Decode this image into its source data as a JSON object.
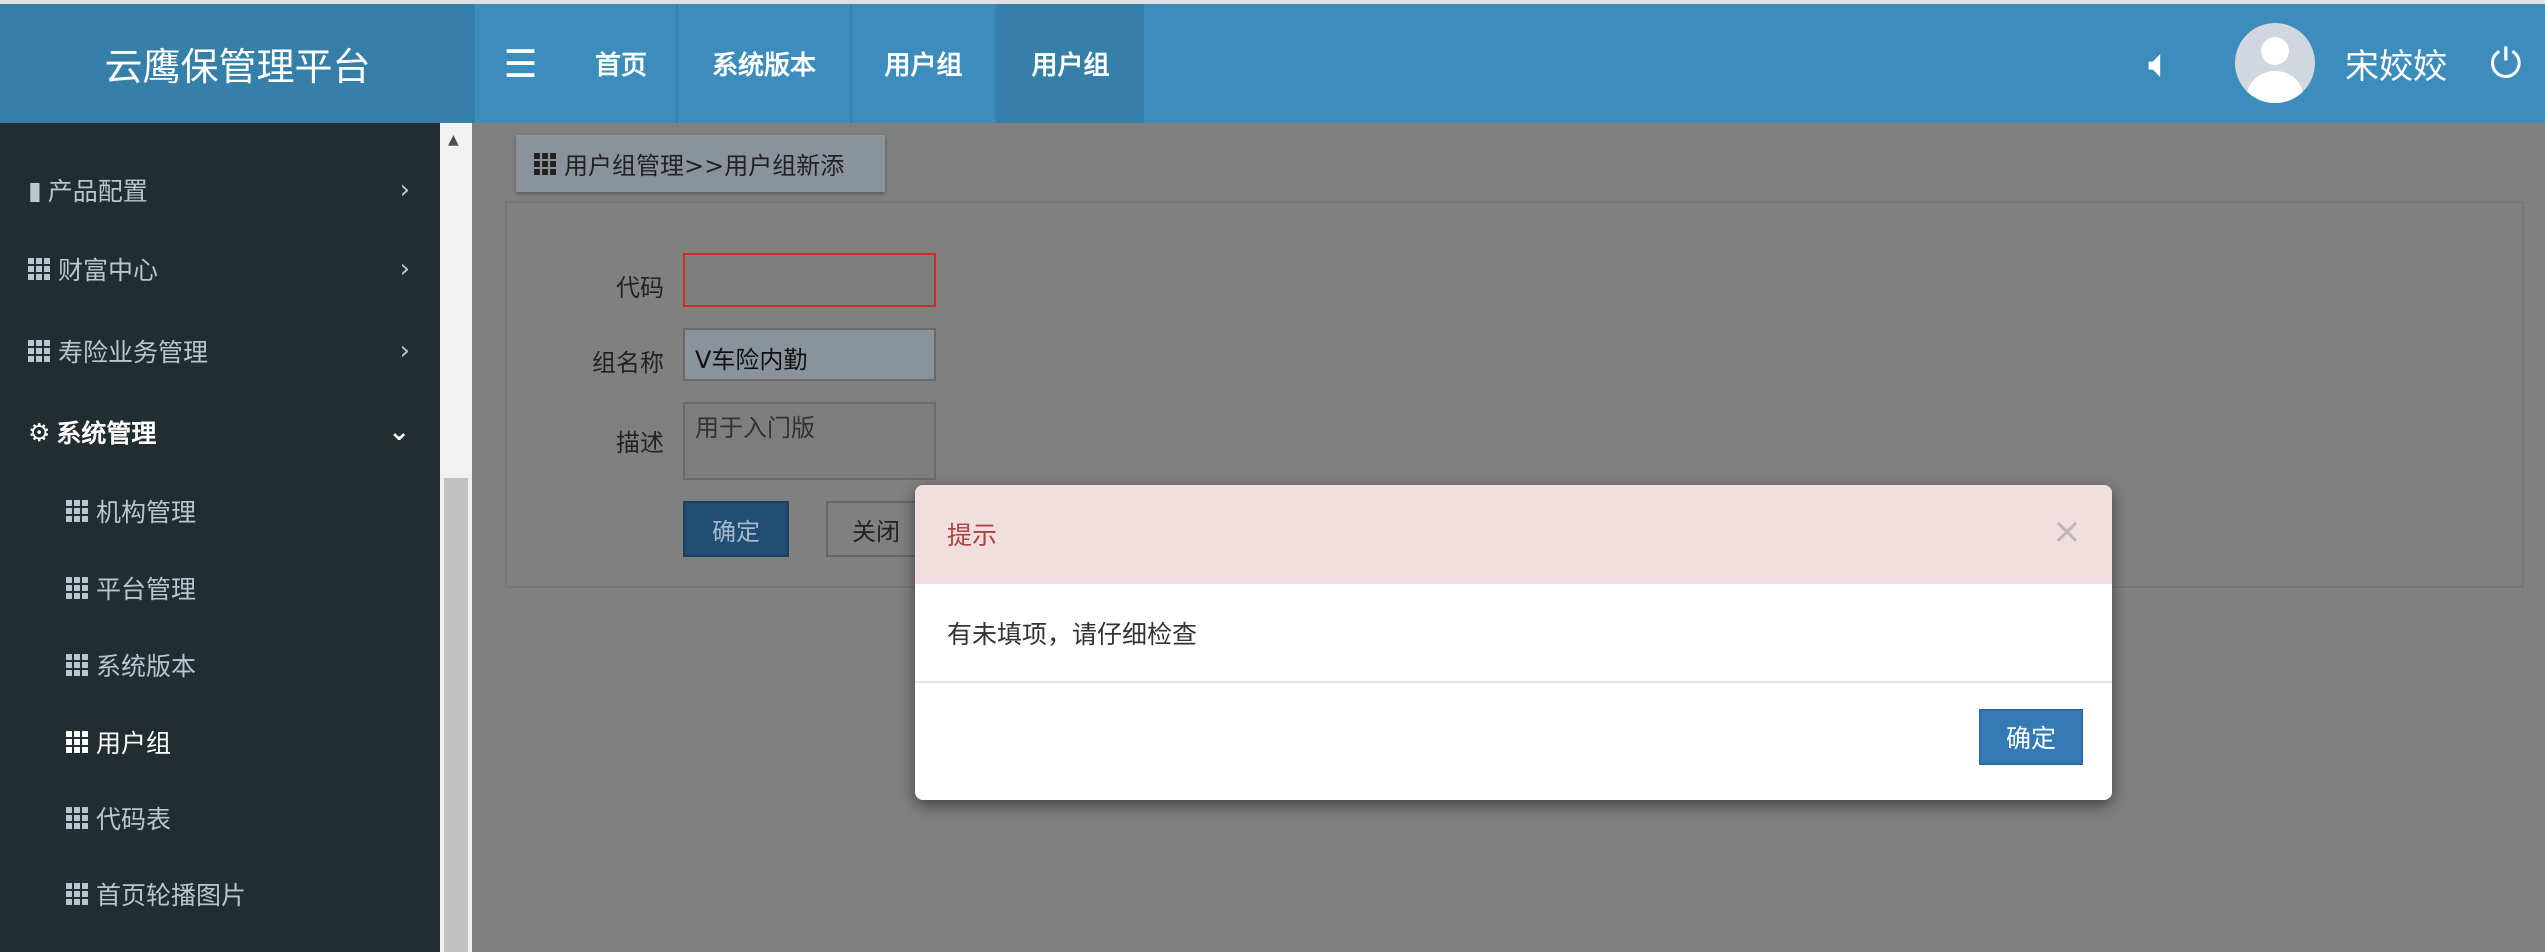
{
  "header": {
    "logo": "云鹰保管理平台",
    "nav": [
      "首页",
      "系统版本",
      "用户组",
      "用户组"
    ],
    "user_name": "宋姣姣"
  },
  "sidebar": {
    "items": [
      {
        "label": "产品配置",
        "icon": "book-icon"
      },
      {
        "label": "财富中心",
        "icon": "grid-icon"
      },
      {
        "label": "寿险业务管理",
        "icon": "grid-icon"
      },
      {
        "label": "系统管理",
        "icon": "gear-icon"
      }
    ],
    "sub_items": [
      "机构管理",
      "平台管理",
      "系统版本",
      "用户组",
      "代码表",
      "首页轮播图片"
    ]
  },
  "breadcrumb": "用户组管理>>用户组新添",
  "form": {
    "code_label": "代码",
    "code_value": "",
    "name_label": "组名称",
    "name_value": "V车险内勤",
    "desc_label": "描述",
    "desc_value": "用于入门版",
    "confirm": "确定",
    "close": "关闭"
  },
  "modal": {
    "title": "提示",
    "message": "有未填项，请仔细检查",
    "ok": "确定",
    "close": "×"
  },
  "colors": {
    "primary": "#3c8dbc",
    "sidebar": "#222d32",
    "modal_header": "#f2dede",
    "error": "#a94442"
  }
}
